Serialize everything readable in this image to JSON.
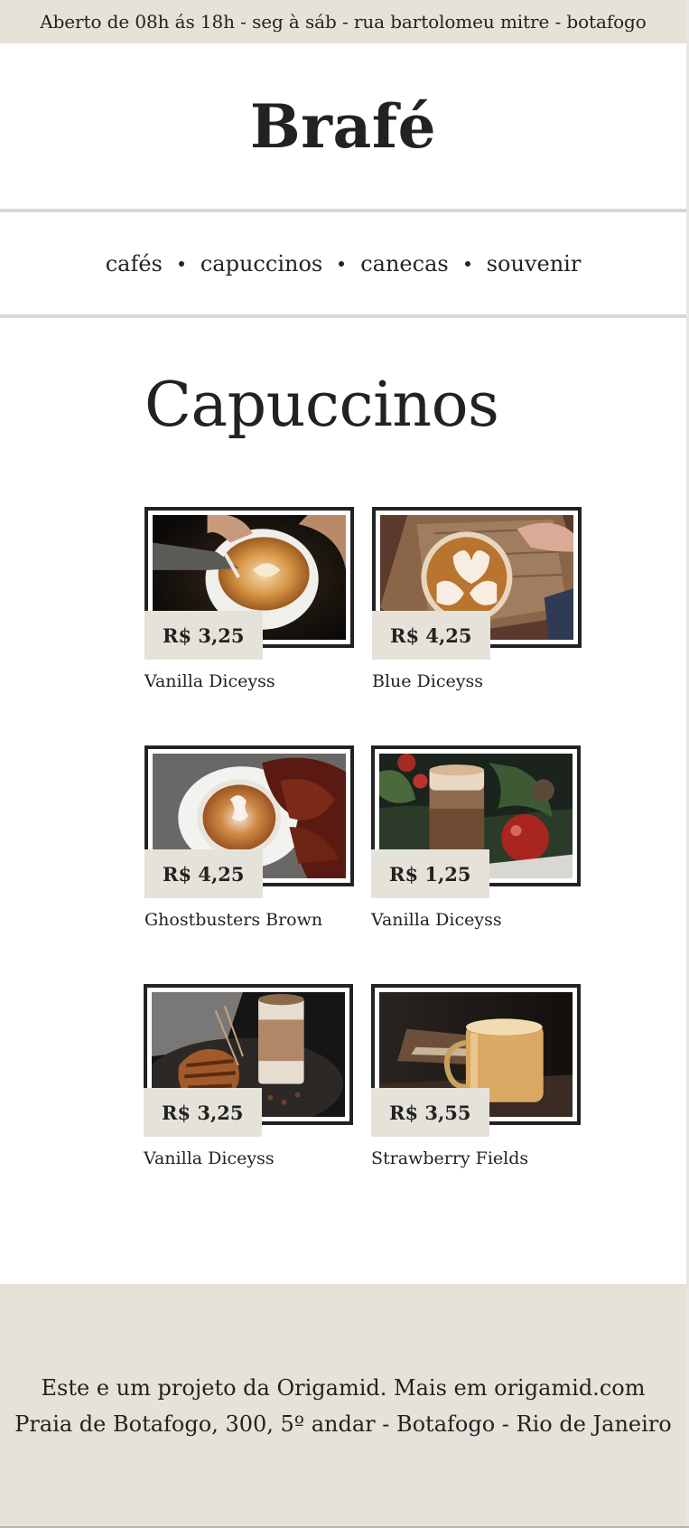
{
  "topbar": {
    "text": "Aberto de 08h ás 18h - seg à sáb - rua bartolomeu mitre - botafogo"
  },
  "header": {
    "logo": "Brafé"
  },
  "nav": {
    "items": [
      {
        "label": "cafés"
      },
      {
        "label": "capuccinos"
      },
      {
        "label": "canecas"
      },
      {
        "label": "souvenir"
      }
    ]
  },
  "main": {
    "title": "Capuccinos",
    "products": [
      {
        "price": "R$ 3,25",
        "name": "Vanilla Diceyss",
        "image": "latte-art-pour-photo"
      },
      {
        "price": "R$ 4,25",
        "name": "Blue Diceyss",
        "image": "latte-art-wooden-tray-photo"
      },
      {
        "price": "R$ 4,25",
        "name": "Ghostbusters Brown",
        "image": "latte-art-autumn-leaves-photo"
      },
      {
        "price": "R$ 1,25",
        "name": "Vanilla Diceyss",
        "image": "christmas-latte-glass-photo"
      },
      {
        "price": "R$ 3,25",
        "name": "Vanilla Diceyss",
        "image": "pastry-and-latte-photo"
      },
      {
        "price": "R$ 3,55",
        "name": "Strawberry Fields",
        "image": "glass-mug-coffee-photo"
      }
    ]
  },
  "footer": {
    "line1": "Este e um projeto da Origamid. Mais em origamid.com",
    "line2": "Praia de Botafogo, 300, 5º andar - Botafogo - Rio de Janeiro"
  },
  "colors": {
    "beige": "#e5e3d9",
    "text": "#222222",
    "divider": "#d9d8d1"
  }
}
